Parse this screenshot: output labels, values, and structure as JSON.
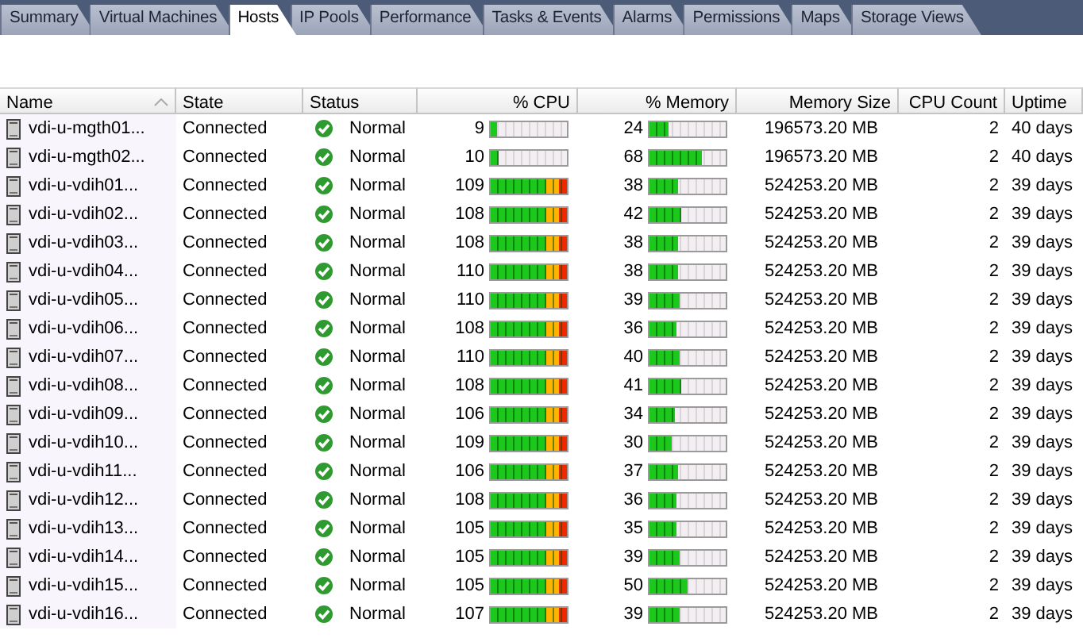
{
  "tabs": [
    {
      "label": "Summary",
      "selected": false
    },
    {
      "label": "Virtual Machines",
      "selected": false
    },
    {
      "label": "Hosts",
      "selected": true
    },
    {
      "label": "IP Pools",
      "selected": false
    },
    {
      "label": "Performance",
      "selected": false
    },
    {
      "label": "Tasks & Events",
      "selected": false
    },
    {
      "label": "Alarms",
      "selected": false
    },
    {
      "label": "Permissions",
      "selected": false
    },
    {
      "label": "Maps",
      "selected": false
    },
    {
      "label": "Storage Views",
      "selected": false
    }
  ],
  "table": {
    "columns": [
      {
        "label": "Name",
        "sorted": true
      },
      {
        "label": "State",
        "sorted": false
      },
      {
        "label": "Status",
        "sorted": false
      },
      {
        "label": "% CPU",
        "sorted": false
      },
      {
        "label": "% Memory",
        "sorted": false
      },
      {
        "label": "Memory Size",
        "sorted": false
      },
      {
        "label": "CPU Count",
        "sorted": false
      },
      {
        "label": "Uptime",
        "sorted": false
      }
    ],
    "rows": [
      {
        "name": "vdi-u-mgth01...",
        "state": "Connected",
        "status": "Normal",
        "cpu": {
          "value": "9",
          "level": 0.09
        },
        "memory": {
          "value": "24",
          "level": 0.24
        },
        "memory_size": "196573.20 MB",
        "cpu_count": "2",
        "uptime": "40 days"
      },
      {
        "name": "vdi-u-mgth02...",
        "state": "Connected",
        "status": "Normal",
        "cpu": {
          "value": "10",
          "level": 0.1
        },
        "memory": {
          "value": "68",
          "level": 0.68
        },
        "memory_size": "196573.20 MB",
        "cpu_count": "2",
        "uptime": "40 days"
      },
      {
        "name": "vdi-u-vdih01...",
        "state": "Connected",
        "status": "Normal",
        "cpu": {
          "value": "109",
          "level": 1
        },
        "memory": {
          "value": "38",
          "level": 0.38
        },
        "memory_size": "524253.20 MB",
        "cpu_count": "2",
        "uptime": "39 days"
      },
      {
        "name": "vdi-u-vdih02...",
        "state": "Connected",
        "status": "Normal",
        "cpu": {
          "value": "108",
          "level": 1
        },
        "memory": {
          "value": "42",
          "level": 0.42
        },
        "memory_size": "524253.20 MB",
        "cpu_count": "2",
        "uptime": "39 days"
      },
      {
        "name": "vdi-u-vdih03...",
        "state": "Connected",
        "status": "Normal",
        "cpu": {
          "value": "108",
          "level": 1
        },
        "memory": {
          "value": "38",
          "level": 0.38
        },
        "memory_size": "524253.20 MB",
        "cpu_count": "2",
        "uptime": "39 days"
      },
      {
        "name": "vdi-u-vdih04...",
        "state": "Connected",
        "status": "Normal",
        "cpu": {
          "value": "110",
          "level": 1
        },
        "memory": {
          "value": "38",
          "level": 0.38
        },
        "memory_size": "524253.20 MB",
        "cpu_count": "2",
        "uptime": "39 days"
      },
      {
        "name": "vdi-u-vdih05...",
        "state": "Connected",
        "status": "Normal",
        "cpu": {
          "value": "110",
          "level": 1
        },
        "memory": {
          "value": "39",
          "level": 0.39
        },
        "memory_size": "524253.20 MB",
        "cpu_count": "2",
        "uptime": "39 days"
      },
      {
        "name": "vdi-u-vdih06...",
        "state": "Connected",
        "status": "Normal",
        "cpu": {
          "value": "108",
          "level": 1
        },
        "memory": {
          "value": "36",
          "level": 0.36
        },
        "memory_size": "524253.20 MB",
        "cpu_count": "2",
        "uptime": "39 days"
      },
      {
        "name": "vdi-u-vdih07...",
        "state": "Connected",
        "status": "Normal",
        "cpu": {
          "value": "110",
          "level": 1
        },
        "memory": {
          "value": "40",
          "level": 0.4
        },
        "memory_size": "524253.20 MB",
        "cpu_count": "2",
        "uptime": "39 days"
      },
      {
        "name": "vdi-u-vdih08...",
        "state": "Connected",
        "status": "Normal",
        "cpu": {
          "value": "108",
          "level": 1
        },
        "memory": {
          "value": "41",
          "level": 0.41
        },
        "memory_size": "524253.20 MB",
        "cpu_count": "2",
        "uptime": "39 days"
      },
      {
        "name": "vdi-u-vdih09...",
        "state": "Connected",
        "status": "Normal",
        "cpu": {
          "value": "106",
          "level": 1
        },
        "memory": {
          "value": "34",
          "level": 0.34
        },
        "memory_size": "524253.20 MB",
        "cpu_count": "2",
        "uptime": "39 days"
      },
      {
        "name": "vdi-u-vdih10...",
        "state": "Connected",
        "status": "Normal",
        "cpu": {
          "value": "109",
          "level": 1
        },
        "memory": {
          "value": "30",
          "level": 0.3
        },
        "memory_size": "524253.20 MB",
        "cpu_count": "2",
        "uptime": "39 days"
      },
      {
        "name": "vdi-u-vdih11...",
        "state": "Connected",
        "status": "Normal",
        "cpu": {
          "value": "106",
          "level": 1
        },
        "memory": {
          "value": "37",
          "level": 0.37
        },
        "memory_size": "524253.20 MB",
        "cpu_count": "2",
        "uptime": "39 days"
      },
      {
        "name": "vdi-u-vdih12...",
        "state": "Connected",
        "status": "Normal",
        "cpu": {
          "value": "108",
          "level": 1
        },
        "memory": {
          "value": "36",
          "level": 0.36
        },
        "memory_size": "524253.20 MB",
        "cpu_count": "2",
        "uptime": "39 days"
      },
      {
        "name": "vdi-u-vdih13...",
        "state": "Connected",
        "status": "Normal",
        "cpu": {
          "value": "105",
          "level": 1
        },
        "memory": {
          "value": "35",
          "level": 0.35
        },
        "memory_size": "524253.20 MB",
        "cpu_count": "2",
        "uptime": "39 days"
      },
      {
        "name": "vdi-u-vdih14...",
        "state": "Connected",
        "status": "Normal",
        "cpu": {
          "value": "105",
          "level": 1
        },
        "memory": {
          "value": "39",
          "level": 0.39
        },
        "memory_size": "524253.20 MB",
        "cpu_count": "2",
        "uptime": "39 days"
      },
      {
        "name": "vdi-u-vdih15...",
        "state": "Connected",
        "status": "Normal",
        "cpu": {
          "value": "105",
          "level": 1
        },
        "memory": {
          "value": "50",
          "level": 0.5
        },
        "memory_size": "524253.20 MB",
        "cpu_count": "2",
        "uptime": "39 days"
      },
      {
        "name": "vdi-u-vdih16...",
        "state": "Connected",
        "status": "Normal",
        "cpu": {
          "value": "107",
          "level": 1
        },
        "memory": {
          "value": "39",
          "level": 0.39
        },
        "memory_size": "524253.20 MB",
        "cpu_count": "2",
        "uptime": "39 days"
      }
    ]
  }
}
